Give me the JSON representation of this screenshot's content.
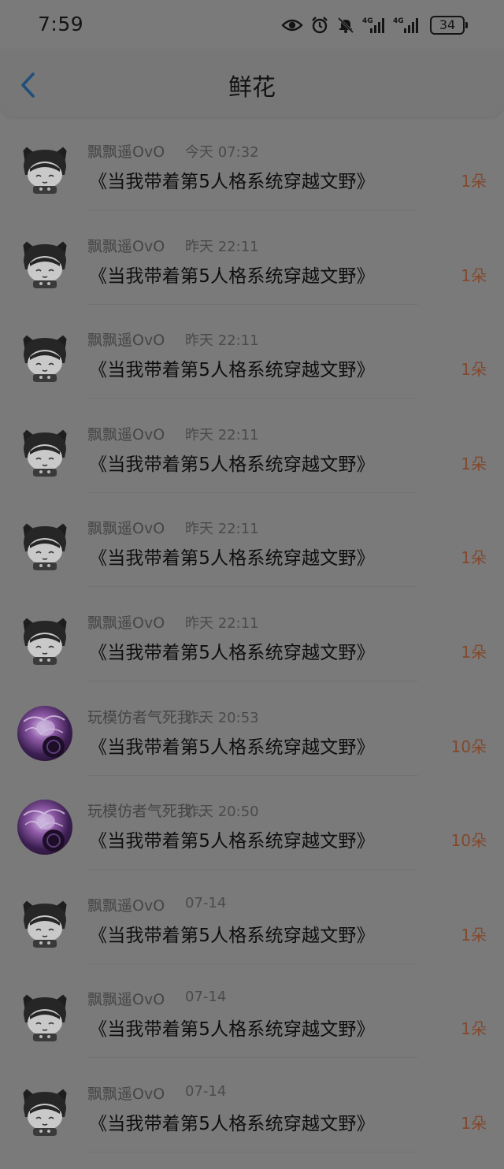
{
  "status_bar": {
    "time": "7:59",
    "battery": "34",
    "network_1": "4G",
    "network_2": "4G"
  },
  "header": {
    "title": "鲜花"
  },
  "items": [
    {
      "user": "飘飘遥OvO",
      "time": "今天 07:32",
      "book": "《当我带着第5人格系统穿越文野》",
      "count": "1朵",
      "avatar": "cat-avatar"
    },
    {
      "user": "飘飘遥OvO",
      "time": "昨天 22:11",
      "book": "《当我带着第5人格系统穿越文野》",
      "count": "1朵",
      "avatar": "cat-avatar"
    },
    {
      "user": "飘飘遥OvO",
      "time": "昨天 22:11",
      "book": "《当我带着第5人格系统穿越文野》",
      "count": "1朵",
      "avatar": "cat-avatar"
    },
    {
      "user": "飘飘遥OvO",
      "time": "昨天 22:11",
      "book": "《当我带着第5人格系统穿越文野》",
      "count": "1朵",
      "avatar": "cat-avatar"
    },
    {
      "user": "飘飘遥OvO",
      "time": "昨天 22:11",
      "book": "《当我带着第5人格系统穿越文野》",
      "count": "1朵",
      "avatar": "cat-avatar"
    },
    {
      "user": "飘飘遥OvO",
      "time": "昨天 22:11",
      "book": "《当我带着第5人格系统穿越文野》",
      "count": "1朵",
      "avatar": "cat-avatar"
    },
    {
      "user": "玩模仿者气死我…",
      "time": "昨天 20:53",
      "book": "《当我带着第5人格系统穿越文野》",
      "count": "10朵",
      "avatar": "purple-avatar"
    },
    {
      "user": "玩模仿者气死我…",
      "time": "昨天 20:50",
      "book": "《当我带着第5人格系统穿越文野》",
      "count": "10朵",
      "avatar": "purple-avatar"
    },
    {
      "user": "飘飘遥OvO",
      "time": "07-14",
      "book": "《当我带着第5人格系统穿越文野》",
      "count": "1朵",
      "avatar": "cat-avatar"
    },
    {
      "user": "飘飘遥OvO",
      "time": "07-14",
      "book": "《当我带着第5人格系统穿越文野》",
      "count": "1朵",
      "avatar": "cat-avatar"
    },
    {
      "user": "飘飘遥OvO",
      "time": "07-14",
      "book": "《当我带着第5人格系统穿越文野》",
      "count": "1朵",
      "avatar": "cat-avatar"
    }
  ]
}
